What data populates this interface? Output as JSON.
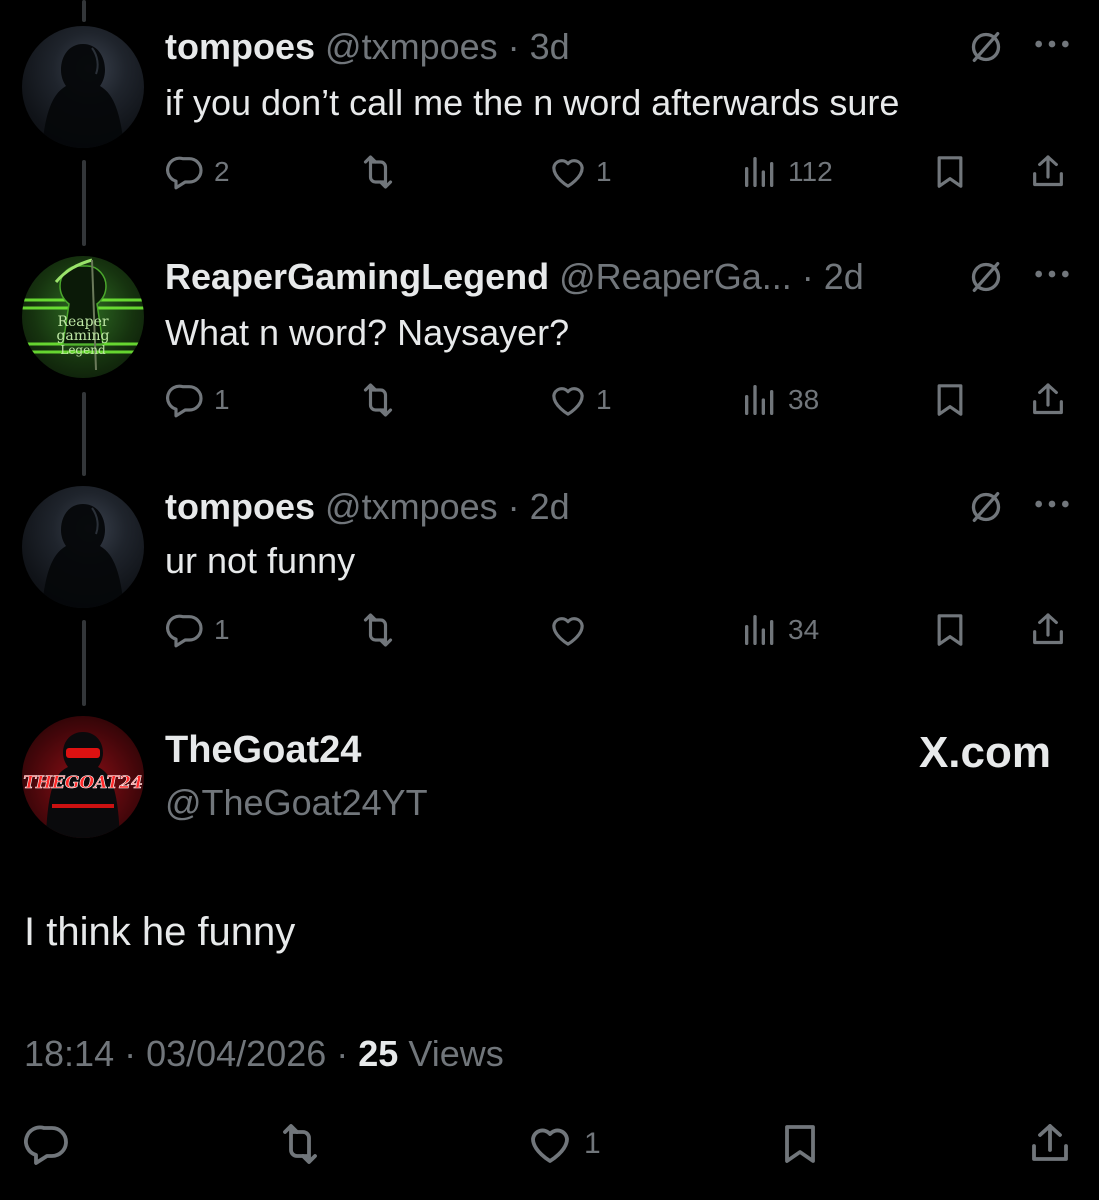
{
  "thread": [
    {
      "name": "tompoes",
      "handle": "@txmpoes",
      "time": "3d",
      "text": "if you don’t call me the n word afterwards sure",
      "replies": "2",
      "reposts": "",
      "likes": "1",
      "views": "112"
    },
    {
      "name": "ReaperGamingLegend",
      "handle": "@ReaperGa...",
      "time": "2d",
      "text": "What n word? Naysayer?",
      "replies": "1",
      "reposts": "",
      "likes": "1",
      "views": "38",
      "avatar_text": "Reaper gaming Legend"
    },
    {
      "name": "tompoes",
      "handle": "@txmpoes",
      "time": "2d",
      "text": "ur not funny",
      "replies": "1",
      "reposts": "",
      "likes": "",
      "views": "34"
    }
  ],
  "main": {
    "name": "TheGoat24",
    "handle": "@TheGoat24YT",
    "avatar_text": "THEGOAT24",
    "brand": "X.com",
    "text": "I think he funny",
    "time": "18:14",
    "date": "03/04/2026",
    "views_count": "25",
    "views_label": "Views",
    "likes": "1"
  },
  "icons": {
    "reply": "reply-icon",
    "repost": "repost-icon",
    "like": "heart-icon",
    "views": "views-chart-icon",
    "bookmark": "bookmark-icon",
    "share": "share-icon",
    "mute": "mute-icon",
    "more": "more-icon"
  },
  "colors": {
    "background": "#000000",
    "text": "#e7e9ea",
    "muted": "#71767b"
  }
}
